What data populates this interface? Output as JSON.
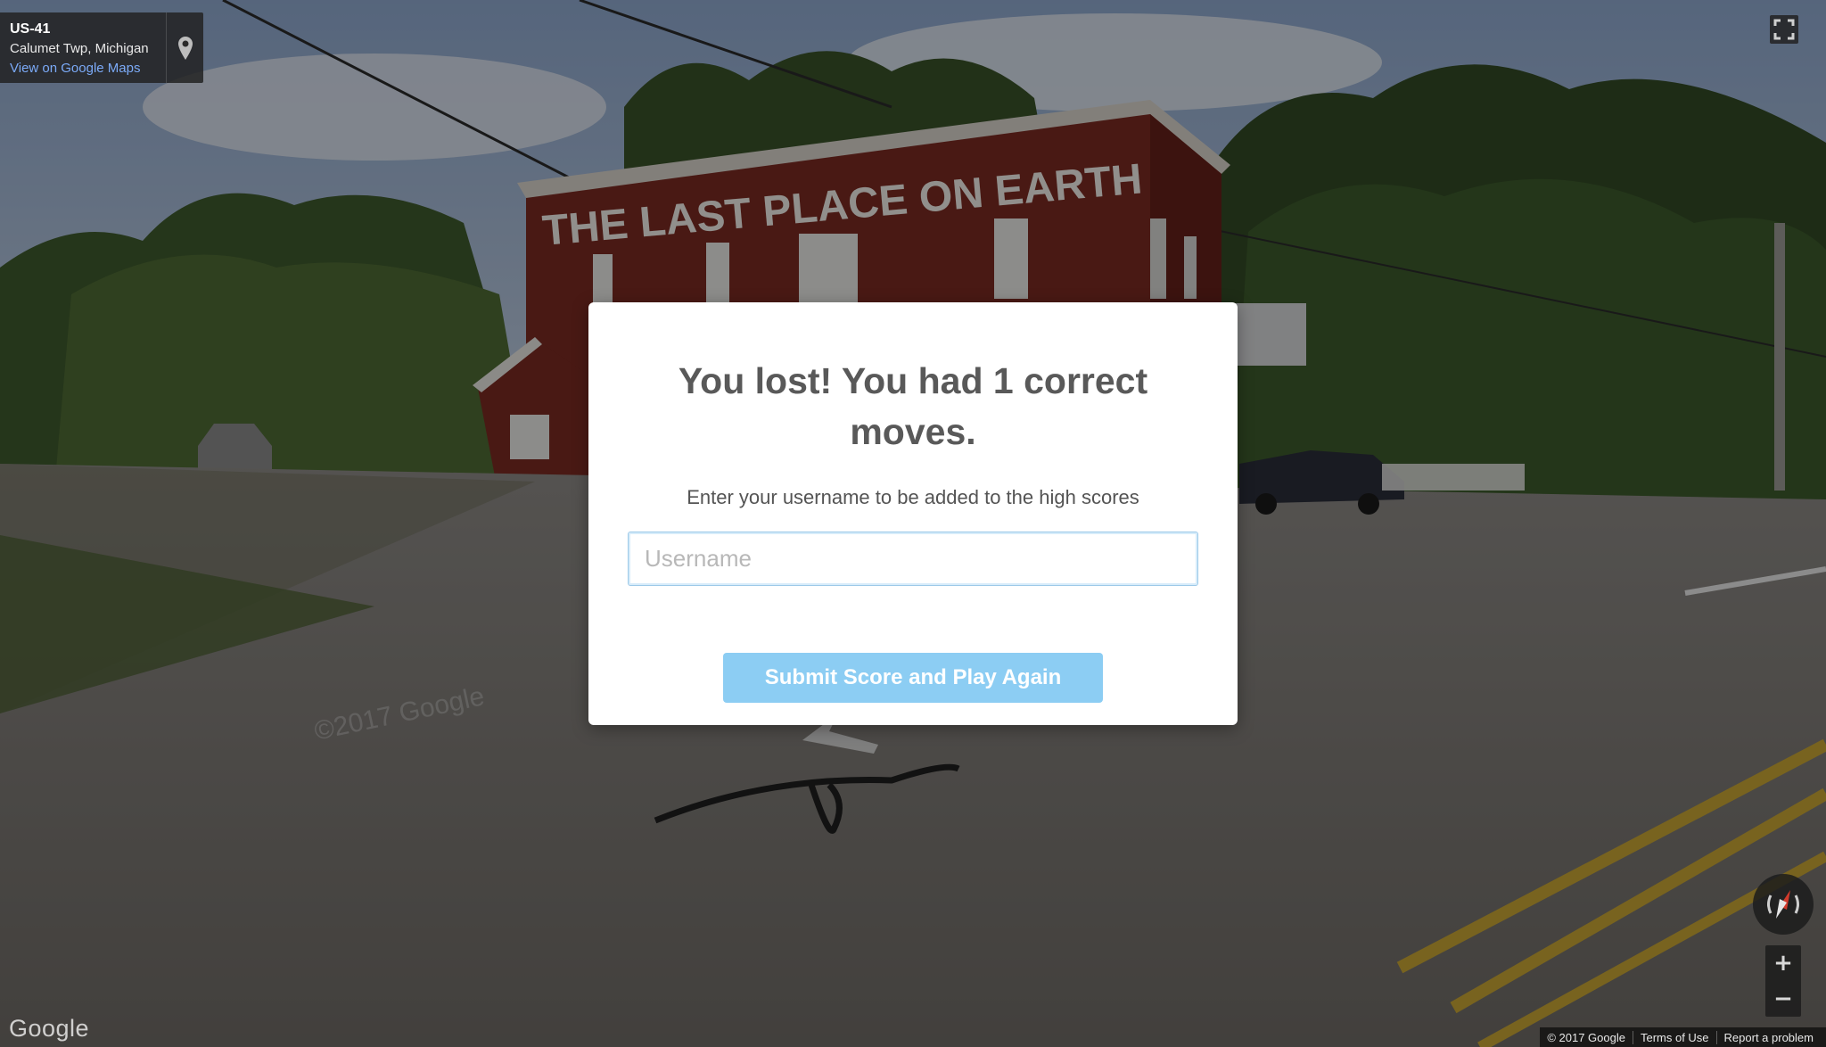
{
  "address_card": {
    "title": "US-41",
    "subtitle": "Calumet Twp, Michigan",
    "link_text": "View on Google Maps",
    "pin_icon": "map-pin-icon"
  },
  "scene": {
    "sign_text": "THE LAST PLACE ON EARTH",
    "watermark": "©2017 Google"
  },
  "modal": {
    "title": "You lost! You had 1 correct moves.",
    "subtitle": "Enter your username to be added to the high scores",
    "username_placeholder": "Username",
    "username_value": "",
    "submit_label": "Submit Score and Play Again"
  },
  "controls": {
    "fullscreen_icon": "fullscreen-icon",
    "compass_icon": "compass-icon",
    "zoom_in_label": "+",
    "zoom_out_label": "−"
  },
  "footer": {
    "google_logo": "Google",
    "copyright": "© 2017 Google",
    "terms": "Terms of Use",
    "report": "Report a problem"
  },
  "colors": {
    "modal_bg": "#ffffff",
    "title_text": "#595959",
    "button_bg": "#8ccdf3",
    "link_blue": "#7baaf7",
    "building_red": "#7a2a22"
  }
}
